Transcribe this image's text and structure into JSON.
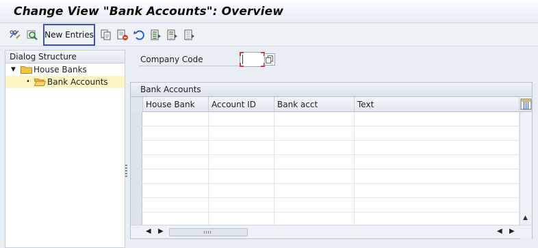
{
  "window": {
    "title": "Change View \"Bank Accounts\": Overview"
  },
  "toolbar": {
    "new_entries_label": "New Entries",
    "icons": [
      "display-change-icon",
      "details-icon",
      "new-entries-button",
      "copy-icon",
      "delete-icon",
      "undo-change-icon",
      "select-all-icon",
      "select-block-icon",
      "deselect-all-icon"
    ]
  },
  "dialog_structure": {
    "header": "Dialog Structure",
    "items": [
      {
        "label": "House Banks",
        "expanded": true,
        "selected": false
      },
      {
        "label": "Bank Accounts",
        "expanded": false,
        "selected": true
      }
    ]
  },
  "company_code": {
    "label": "Company Code",
    "value": ""
  },
  "bank_accounts_table": {
    "title": "Bank Accounts",
    "columns": [
      "House Bank",
      "Account ID",
      "Bank acct",
      "Text"
    ],
    "rows": [
      [
        "",
        "",
        "",
        ""
      ],
      [
        "",
        "",
        "",
        ""
      ],
      [
        "",
        "",
        "",
        ""
      ],
      [
        "",
        "",
        "",
        ""
      ],
      [
        "",
        "",
        "",
        ""
      ],
      [
        "",
        "",
        "",
        ""
      ],
      [
        "",
        "",
        "",
        ""
      ],
      [
        "",
        "",
        "",
        ""
      ]
    ]
  },
  "colors": {
    "title_bar": "#e7edf5",
    "selected_tree_item": "#fdf5c3",
    "focus_box": "#3e4fc4",
    "required_marker": "#d23b3b",
    "folder_yellow": "#f5c542"
  }
}
